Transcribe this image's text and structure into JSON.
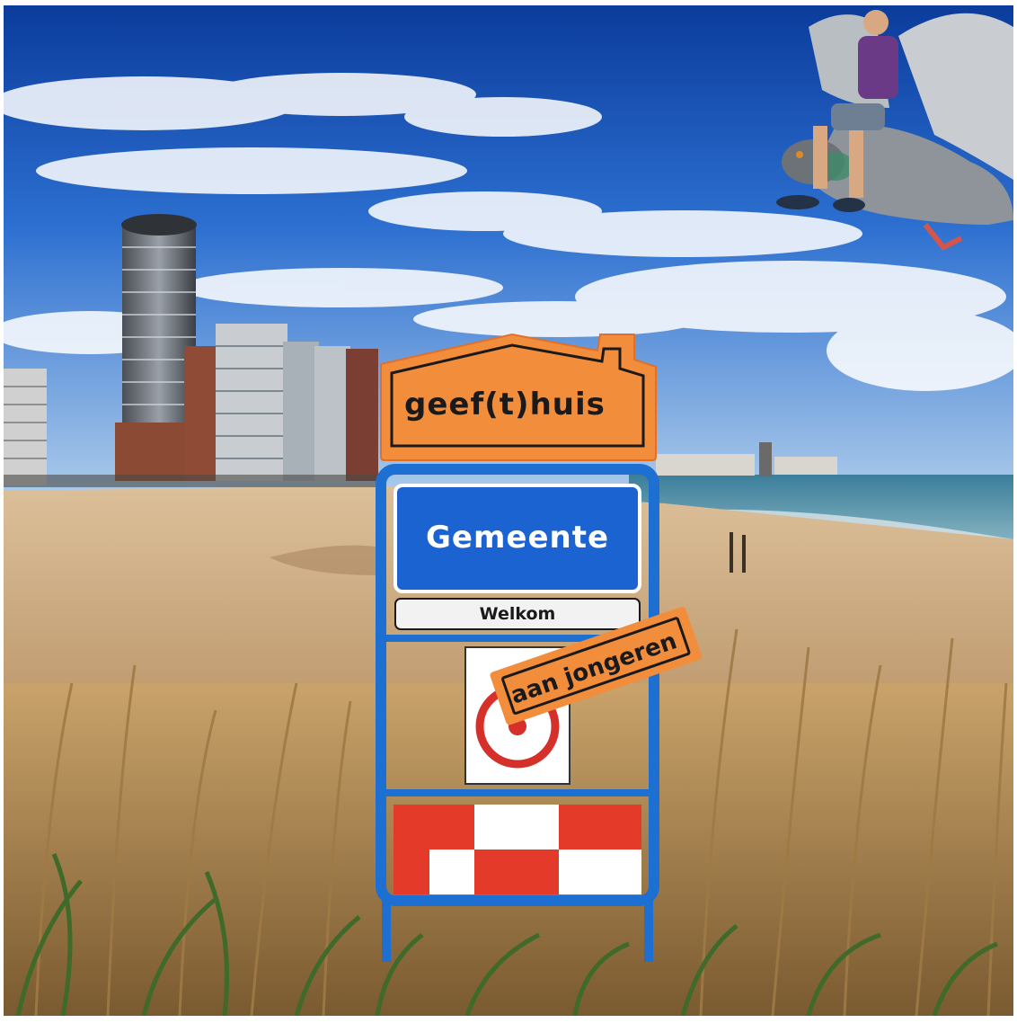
{
  "sign": {
    "logo_text": "geef(t)huis",
    "title": "Gemeente",
    "welcome": "Welkom",
    "banner": "aan jongeren"
  },
  "colors": {
    "sky_top": "#0d3f9e",
    "sky_bottom": "#7fb3e6",
    "sand": "#c9a57a",
    "sea": "#2f6f8f",
    "sign_blue": "#1b63d0",
    "sign_frame": "#1d6fd1",
    "orange": "#f28d3c",
    "stripe_red": "#e43a2a",
    "grass": "#b08a55"
  },
  "icons": [
    "house-logo-icon",
    "no-entry-sign-icon",
    "pigeon-icon",
    "person-icon"
  ]
}
